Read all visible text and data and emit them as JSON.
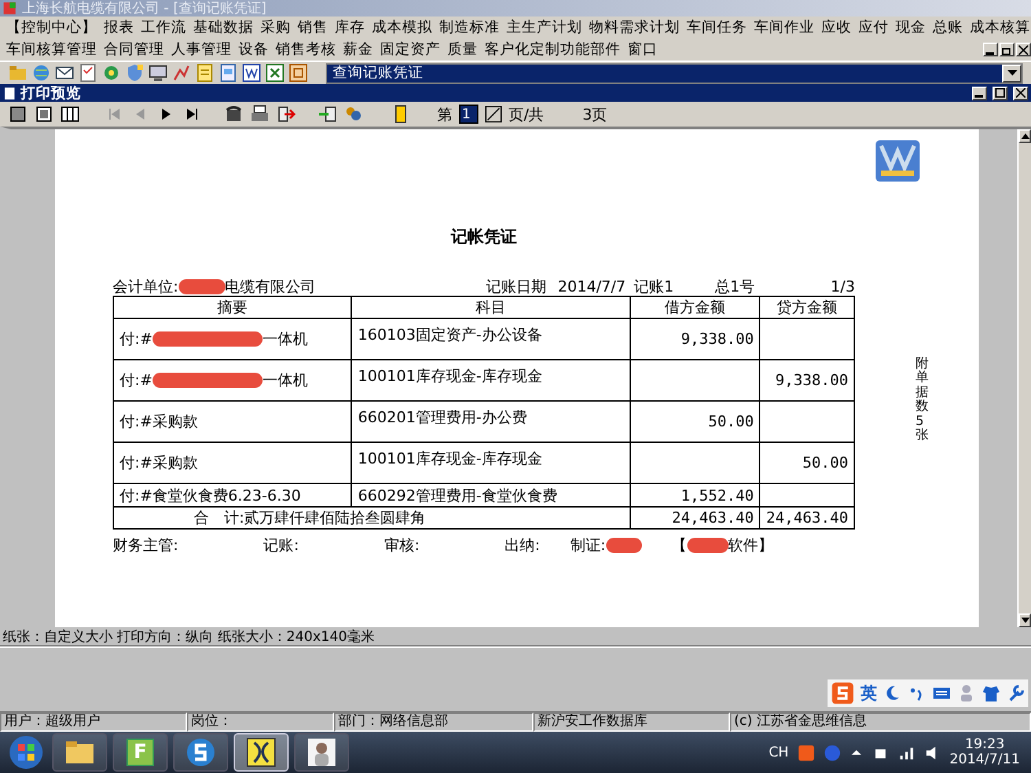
{
  "window": {
    "title": "上海长航电缆有限公司 - [查询记账凭证]"
  },
  "menu_primary": [
    "【控制中心】",
    "报表",
    "工作流",
    "基础数据",
    "采购",
    "销售",
    "库存",
    "成本模拟",
    "制造标准",
    "主生产计划",
    "物料需求计划",
    "车间任务",
    "车间作业",
    "应收",
    "应付",
    "现金",
    "总账",
    "成本核算"
  ],
  "menu_secondary": [
    "车间核算管理",
    "合同管理",
    "人事管理",
    "设备",
    "销售考核",
    "薪金",
    "固定资产",
    "质量",
    "客户化定制功能部件",
    "窗口"
  ],
  "window_selector": {
    "value": "查询记账凭证"
  },
  "preview": {
    "title": "打印预览",
    "nav_buttons": [
      {
        "kind": "first",
        "disabled": true
      },
      {
        "kind": "prev",
        "disabled": true
      },
      {
        "kind": "next",
        "disabled": false
      },
      {
        "kind": "last",
        "disabled": false
      }
    ],
    "page_prefix": "第",
    "page_value": "1",
    "page_mid": "页/共",
    "page_total": "3页"
  },
  "voucher": {
    "title": "记帐凭证",
    "unit_label": "会计单位:",
    "unit_name": "电缆有限公司",
    "unit_redacted": true,
    "date_label": "记账日期",
    "date": "2014/7/7",
    "voucher_no": "记账1",
    "total_no": "总1号",
    "page": "1/3",
    "columns": [
      "摘要",
      "科目",
      "借方金额",
      "贷方金额"
    ],
    "rows": [
      {
        "summary": "付:#",
        "summary_tail": "一体机",
        "redacted": true,
        "subject": "160103固定资产-办公设备",
        "debit": "9,338.00",
        "credit": ""
      },
      {
        "summary": "付:#",
        "summary_tail": "一体机",
        "redacted": true,
        "subject": "100101库存现金-库存现金",
        "debit": "",
        "credit": "9,338.00"
      },
      {
        "summary": "付:#采购款",
        "summary_tail": "",
        "redacted": false,
        "subject": "660201管理费用-办公费",
        "debit": "50.00",
        "credit": ""
      },
      {
        "summary": "付:#采购款",
        "summary_tail": "",
        "redacted": false,
        "subject": "100101库存现金-库存现金",
        "debit": "",
        "credit": "50.00"
      },
      {
        "summary": "付:#食堂伙食费6.23-6.30",
        "summary_tail": "",
        "redacted": false,
        "subject": "660292管理费用-食堂伙食费",
        "debit": "1,552.40",
        "credit": ""
      }
    ],
    "total_label": "合　计:",
    "total_words": "贰万肆仟肆佰陆拾叁圆肆角",
    "total_debit": "24,463.40",
    "total_credit": "24,463.40",
    "signatures": [
      {
        "label": "财务主管:",
        "redacted": false
      },
      {
        "label": "记账:",
        "redacted": false
      },
      {
        "label": "审核:",
        "redacted": false
      },
      {
        "label": "出纳:",
        "redacted": false
      },
      {
        "label": "制证:",
        "redacted": true
      }
    ],
    "software_open": "【",
    "software_close": "软件】",
    "software_redacted": true,
    "attachment": "附单据数5张"
  },
  "paper_info": "纸张：自定义大小  打印方向：纵向  纸张大小：240x140毫米",
  "status_bar": [
    "用户：超级用户",
    "岗位：",
    "部门：网络信息部",
    "新沪安工作数据库",
    "(c) 江苏省金思维信息"
  ],
  "ime_bar": {
    "mode": "英"
  },
  "taskbar": {
    "apps": [
      {
        "kind": "folder",
        "selected": false
      },
      {
        "kind": "letter",
        "label": "F",
        "selected": false
      },
      {
        "kind": "browser",
        "selected": false
      },
      {
        "kind": "yellow",
        "selected": true
      },
      {
        "kind": "figure",
        "selected": false
      }
    ],
    "language": "CH",
    "time": "19:23",
    "date": "2014/7/11"
  }
}
